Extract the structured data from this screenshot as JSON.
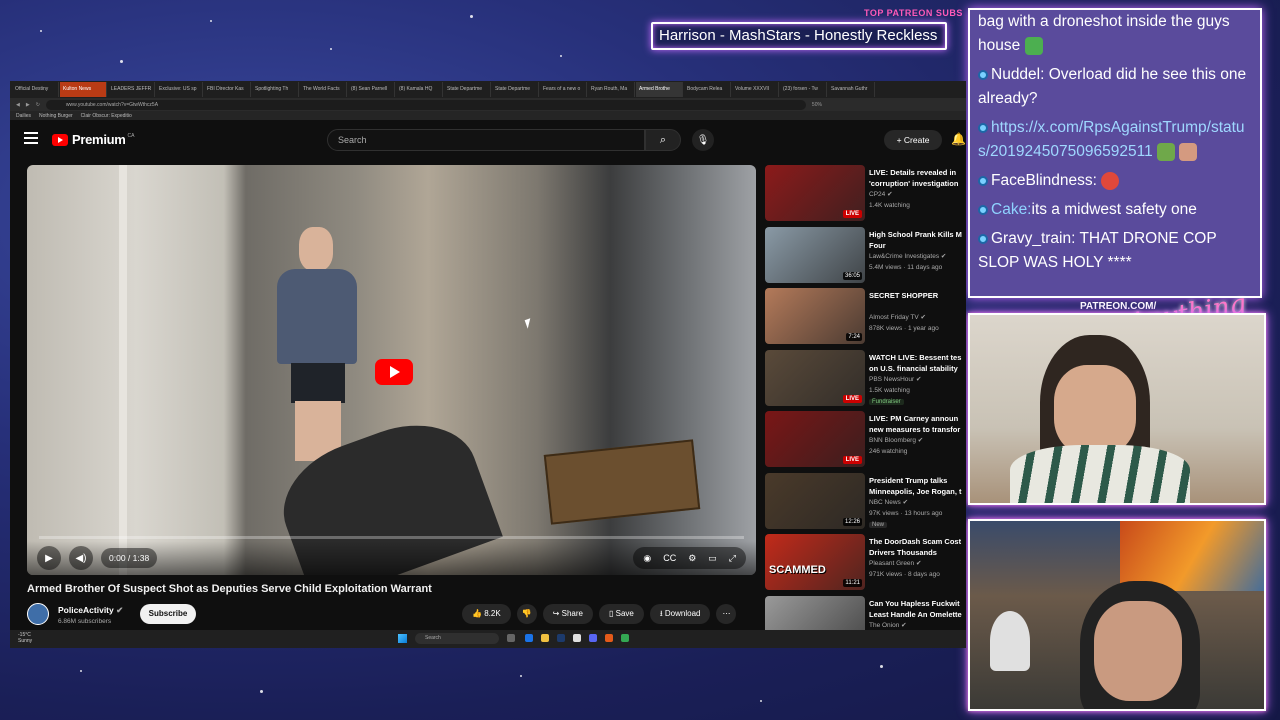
{
  "overlay": {
    "patreon_title": "TOP PATREON SUBS",
    "patreon_ticker": "Harrison - MashStars - Honestly Reckless",
    "patreon_url": "PATREON.COM/",
    "logo_script": "Anything else"
  },
  "chat": {
    "lines": [
      {
        "user": "",
        "text": "bag with a droneshot inside the guys house"
      },
      {
        "user": "Nuddel:",
        "text": "Overload did he see this one already?"
      },
      {
        "user": "",
        "text": "https://x.com/RpsAgainstTrump/status/2019245075096592511",
        "link": true
      },
      {
        "user": "FaceBlindness:",
        "text": ""
      },
      {
        "user": "Cake:",
        "text": "its a midwest safety one"
      },
      {
        "user": "Gravy_train:",
        "text": "THAT DRONE COP SLOP WAS HOLY ****"
      }
    ]
  },
  "browser": {
    "tabs": [
      "Official Destiny",
      "Kulton News",
      "LEADERS JEFFR",
      "Exclusive: US sp",
      "FBI Director Kas",
      "Spotlighting Th",
      "The World Facts",
      "(8) Sean Parnell",
      "(8) Kamala HQ",
      "State Departme",
      "State Departme",
      "Fears of a new o",
      "Ryan Routh, Ma",
      "Armed Brothe",
      "Bodycam Relea",
      "Volume XXXVII",
      "(23) forsen - Tw",
      "Savannah Guthr"
    ],
    "active_tab_index": 13,
    "red_tab_index": 1,
    "url": "www.youtube.com/watch?v=GtwWthcz5A",
    "zoom": "50%",
    "bookmarks": [
      "Dailies",
      "Nothing Burger",
      "Clair Obscur: Expeditio"
    ]
  },
  "youtube": {
    "logo_text": "Premium",
    "logo_country": "CA",
    "search_placeholder": "Search",
    "create_label": "Create",
    "player": {
      "time": "0:00 / 1:38"
    },
    "video_title": "Armed Brother Of Suspect Shot as Deputies Serve Child Exploitation Warrant",
    "channel_name": "PoliceActivity",
    "channel_subs": "6.86M subscribers",
    "subscribe_label": "Subscribe",
    "likes": "8.2K",
    "share_label": "Share",
    "save_label": "Save",
    "download_label": "Download",
    "suggestions": [
      {
        "title": "LIVE: Details revealed in 'corruption' investigation le",
        "channel": "CP24",
        "meta": "1.4K watching",
        "badge": "LIVE",
        "live": true,
        "color": "#8c1a1a"
      },
      {
        "title": "High School Prank Kills M Four",
        "channel": "Law&Crime Investigates",
        "meta": "5.4M views · 11 days ago",
        "badge": "36:05",
        "live": false,
        "color": "#8a9aa6"
      },
      {
        "title": "SECRET SHOPPER",
        "channel": "Almost Friday TV",
        "meta": "878K views · 1 year ago",
        "badge": "7:24",
        "live": false,
        "color": "#b47a5a"
      },
      {
        "title": "WATCH LIVE: Bessent tes on U.S. financial stability",
        "channel": "PBS NewsHour",
        "meta": "1.5K watching",
        "badge": "LIVE",
        "live": true,
        "tag": "Fundraiser",
        "color": "#5a4a3a"
      },
      {
        "title": "LIVE: PM Carney announ new measures to transfor",
        "channel": "BNN Bloomberg",
        "meta": "246 watching",
        "badge": "LIVE",
        "live": true,
        "color": "#7a1616"
      },
      {
        "title": "President Trump talks Minneapolis, Joe Rogan, t",
        "channel": "NBC News",
        "meta": "97K views · 13 hours ago",
        "badge": "12:26",
        "live": false,
        "tag": "New",
        "color": "#4a3a2a"
      },
      {
        "title": "The DoorDash Scam Cost Drivers Thousands",
        "channel": "Pleasant Green",
        "meta": "971K views · 8 days ago",
        "badge": "11:21",
        "live": false,
        "thumb_text": "SCAMMED",
        "color": "#c22a1a"
      },
      {
        "title": "Can You Hapless Fuckwit Least Handle An Omelette",
        "channel": "The Onion",
        "meta": "",
        "badge": "",
        "live": false,
        "color": "#9a9a9a"
      }
    ]
  },
  "taskbar": {
    "weather_temp": "-15°C",
    "weather_desc": "Sunny",
    "search_placeholder": "Search"
  }
}
